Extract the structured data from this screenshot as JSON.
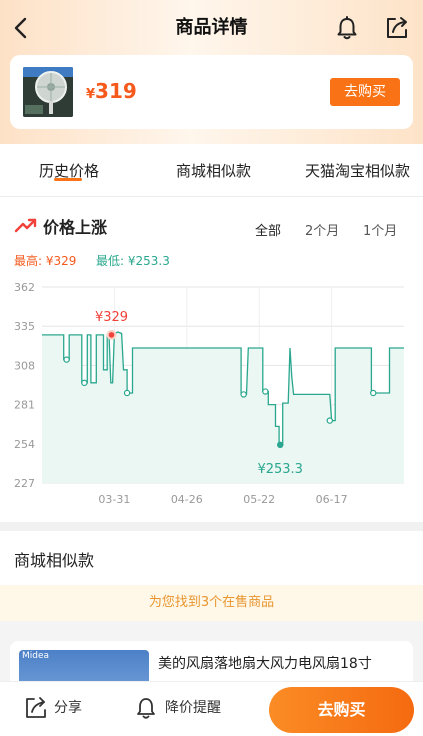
{
  "header": {
    "title": "商品详情"
  },
  "product": {
    "currency": "¥",
    "price": "319",
    "buy_label": "去购买"
  },
  "tabs": [
    {
      "label": "历史价格",
      "active": true
    },
    {
      "label": "商城相似款",
      "active": false
    },
    {
      "label": "天猫淘宝相似款",
      "active": false
    }
  ],
  "trend": {
    "title": "价格上涨",
    "ranges": [
      "全部",
      "2个月",
      "1个月"
    ],
    "active_range": "全部",
    "highest": "最高: ¥329",
    "lowest": "最低: ¥253.3"
  },
  "chart_data": {
    "type": "line",
    "y_ticks": [
      "362",
      "335",
      "308",
      "281",
      "254",
      "227"
    ],
    "x_ticks": [
      "03-31",
      "04-26",
      "05-22",
      "06-17"
    ],
    "ylim": [
      227,
      362
    ],
    "series_color": "#2aa78e",
    "max_label": "¥329",
    "min_label": "¥253.3",
    "max_value": 329,
    "min_value": 253.3,
    "points": [
      [
        0,
        329
      ],
      [
        6,
        329
      ],
      [
        6,
        312
      ],
      [
        7.5,
        312
      ],
      [
        7.5,
        329
      ],
      [
        11,
        329
      ],
      [
        11,
        296
      ],
      [
        12.5,
        296
      ],
      [
        12.5,
        329
      ],
      [
        13.5,
        329
      ],
      [
        13.5,
        296
      ],
      [
        15,
        296
      ],
      [
        15,
        329
      ],
      [
        17,
        329
      ],
      [
        17,
        305
      ],
      [
        18,
        305
      ],
      [
        18,
        329
      ],
      [
        18.5,
        329
      ],
      [
        19,
        296
      ],
      [
        19.5,
        296
      ],
      [
        20,
        330
      ],
      [
        21,
        331
      ],
      [
        22,
        330
      ],
      [
        22.5,
        305
      ],
      [
        23.5,
        305
      ],
      [
        23.5,
        289
      ],
      [
        25,
        289
      ],
      [
        25,
        320
      ],
      [
        55,
        320
      ],
      [
        55,
        288
      ],
      [
        56.5,
        288
      ],
      [
        57,
        320
      ],
      [
        61,
        320
      ],
      [
        61,
        290
      ],
      [
        62.5,
        290
      ],
      [
        62.5,
        281
      ],
      [
        64.5,
        281
      ],
      [
        64.5,
        266
      ],
      [
        65.5,
        266
      ],
      [
        65.5,
        253.3
      ],
      [
        66.5,
        253.3
      ],
      [
        66.5,
        282
      ],
      [
        68,
        282
      ],
      [
        68.5,
        320
      ],
      [
        69,
        300
      ],
      [
        69.5,
        288
      ],
      [
        79.5,
        288
      ],
      [
        80,
        270
      ],
      [
        81,
        270
      ],
      [
        81,
        320
      ],
      [
        91,
        320
      ],
      [
        91,
        289
      ],
      [
        96,
        289
      ],
      [
        96,
        320
      ],
      [
        100,
        320
      ]
    ]
  },
  "similar": {
    "heading": "商城相似款",
    "found_text": "为您找到3个在售商品",
    "first_item": {
      "brand": "Midea",
      "name": "美的风扇落地扇大风力电风扇18寸"
    }
  },
  "bottom": {
    "share_label": "分享",
    "alert_label": "降价提醒",
    "buy_label": "去购买"
  }
}
